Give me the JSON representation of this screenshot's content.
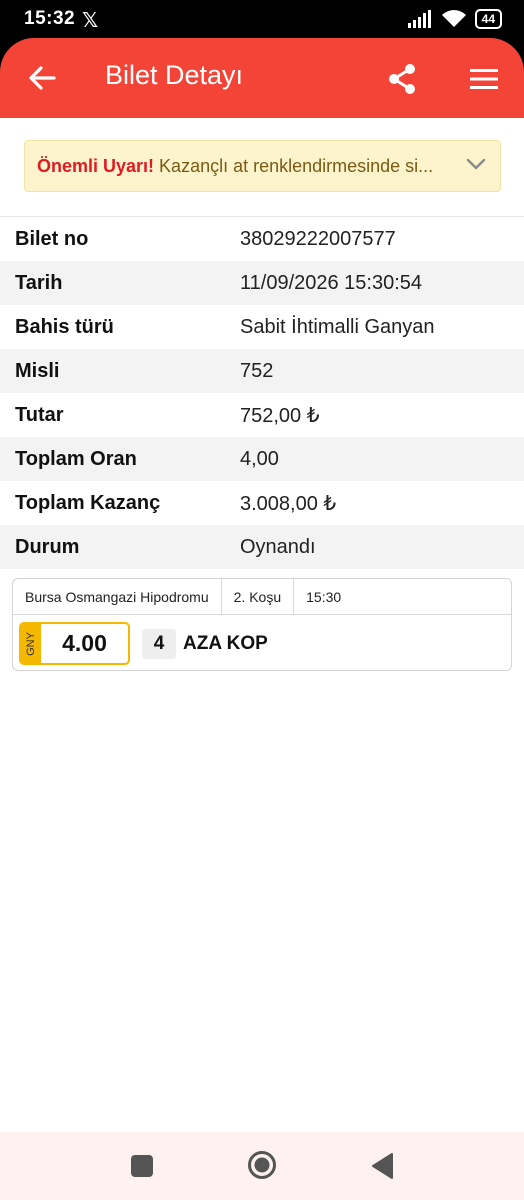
{
  "status_bar": {
    "time": "15:32",
    "x_logo": "𝕏",
    "battery": "44"
  },
  "header": {
    "title": "Bilet Detayı",
    "color": "#f44337"
  },
  "warning": {
    "strong": "Önemli Uyarı!",
    "text": " Kazançlı at renklendirmesinde si..."
  },
  "details": [
    {
      "label": "Bilet no",
      "value": "38029222007577"
    },
    {
      "label": "Tarih",
      "value": "11/09/2026 15:30:54"
    },
    {
      "label": "Bahis türü",
      "value": "Sabit İhtimalli Ganyan"
    },
    {
      "label": "Misli",
      "value": "752"
    },
    {
      "label": "Tutar",
      "value": "752,00 ₺"
    },
    {
      "label": "Toplam Oran",
      "value": "4,00"
    },
    {
      "label": "Toplam Kazanç",
      "value": "3.008,00 ₺"
    },
    {
      "label": "Durum",
      "value": "Oynandı"
    }
  ],
  "race": {
    "venue": "Bursa Osmangazi Hipodromu",
    "race_no": "2. Koşu",
    "time": "15:30",
    "bet_type": "GNY",
    "odds": "4.00",
    "horse_no": "4",
    "horse_name": "AZA KOP"
  },
  "icons": {
    "back": "arrow-left-icon",
    "share": "share-icon",
    "menu": "hamburger-menu-icon",
    "chevron": "chevron-down-icon"
  }
}
